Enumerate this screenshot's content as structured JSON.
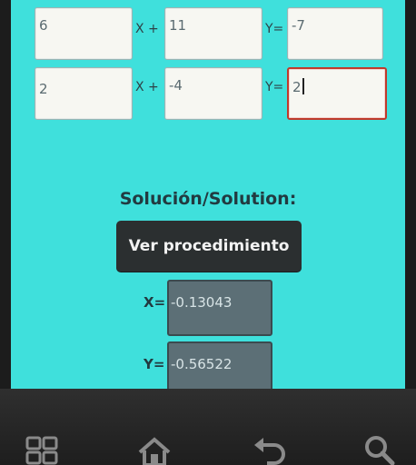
{
  "equation1": {
    "a": "6",
    "op1": "X +",
    "b": "11",
    "op2": "Y=",
    "c": "-7"
  },
  "equation2": {
    "a": "2",
    "op1": "X +",
    "b": "-4",
    "op2": "Y=",
    "c": "2"
  },
  "solution": {
    "title": "Solución/Solution:",
    "button_label": "Ver procedimiento",
    "x_label": "X=",
    "x_value": "-0.13043",
    "y_label": "Y=",
    "y_value": "-0.56522"
  },
  "navbar": {
    "icons": [
      "apps-grid-icon",
      "home-icon",
      "back-icon",
      "search-icon"
    ]
  },
  "colors": {
    "screen_bg": "#3fe0dc",
    "button_bg": "#2b2f30",
    "focus_border": "#c0392b"
  }
}
